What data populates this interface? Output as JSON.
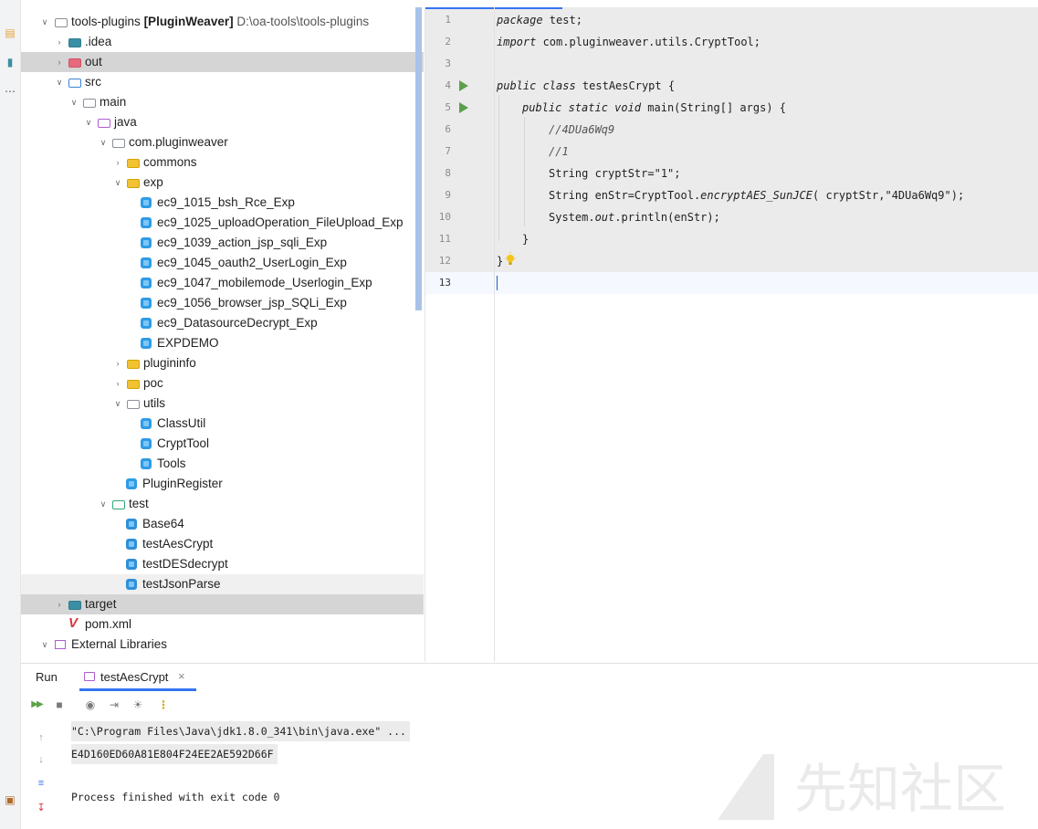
{
  "project_tree": {
    "root": {
      "name": "tools-plugins",
      "module": "[PluginWeaver]",
      "path": "D:\\oa-tools\\tools-plugins"
    },
    "nodes": [
      {
        "label": ".idea"
      },
      {
        "label": "out"
      },
      {
        "label": "src"
      },
      {
        "label": "main"
      },
      {
        "label": "java"
      },
      {
        "label": "com.pluginweaver"
      },
      {
        "label": "commons"
      },
      {
        "label": "exp"
      },
      {
        "label": "ec9_1015_bsh_Rce_Exp"
      },
      {
        "label": "ec9_1025_uploadOperation_FileUpload_Exp"
      },
      {
        "label": "ec9_1039_action_jsp_sqli_Exp"
      },
      {
        "label": "ec9_1045_oauth2_UserLogin_Exp"
      },
      {
        "label": "ec9_1047_mobilemode_Userlogin_Exp"
      },
      {
        "label": "ec9_1056_browser_jsp_SQLi_Exp"
      },
      {
        "label": "ec9_DatasourceDecrypt_Exp"
      },
      {
        "label": "EXPDEMO"
      },
      {
        "label": "plugininfo"
      },
      {
        "label": "poc"
      },
      {
        "label": "utils"
      },
      {
        "label": "ClassUtil"
      },
      {
        "label": "CryptTool"
      },
      {
        "label": "Tools"
      },
      {
        "label": "PluginRegister"
      },
      {
        "label": "test"
      },
      {
        "label": "Base64"
      },
      {
        "label": "testAesCrypt"
      },
      {
        "label": "testDESdecrypt"
      },
      {
        "label": "testJsonParse"
      },
      {
        "label": "target"
      },
      {
        "label": "pom.xml"
      },
      {
        "label": "External Libraries"
      }
    ]
  },
  "editor": {
    "line_numbers": [
      "1",
      "2",
      "3",
      "4",
      "5",
      "6",
      "7",
      "8",
      "9",
      "10",
      "11",
      "12",
      "13"
    ],
    "lines": {
      "l1_kw": "package",
      "l1_rest": " test;",
      "l2_kw": "import",
      "l2_rest": " com.pluginweaver.utils.CryptTool;",
      "l4_kw": "public class",
      "l4_rest": " testAesCrypt {",
      "l5_kw": "public static void",
      "l5_rest": " main(String[] args) {",
      "l6": "//4DUa6Wq9",
      "l7": "//1",
      "l8": "String cryptStr=\"1\";",
      "l9_a": "String enStr=CryptTool.",
      "l9_b": "encryptAES_SunJCE",
      "l9_c": "( cryptStr,\"4DUa6Wq9\");",
      "l10_a": "System.",
      "l10_b": "out",
      "l10_c": ".println(enStr);",
      "l11": "}",
      "l12": "}"
    }
  },
  "run_panel": {
    "run_label": "Run",
    "tab_label": "testAesCrypt",
    "tab_close": "×",
    "console": [
      "\"C:\\Program Files\\Java\\jdk1.8.0_341\\bin\\java.exe\" ...",
      "E4D160ED60A81E804F24EE2AE592D66F",
      "Process finished with exit code 0"
    ]
  },
  "watermark": {
    "text": "先知社区"
  },
  "colors": {
    "accent": "#3574f0",
    "run_green": "#5aa04a",
    "selection": "#d5d5d5"
  }
}
